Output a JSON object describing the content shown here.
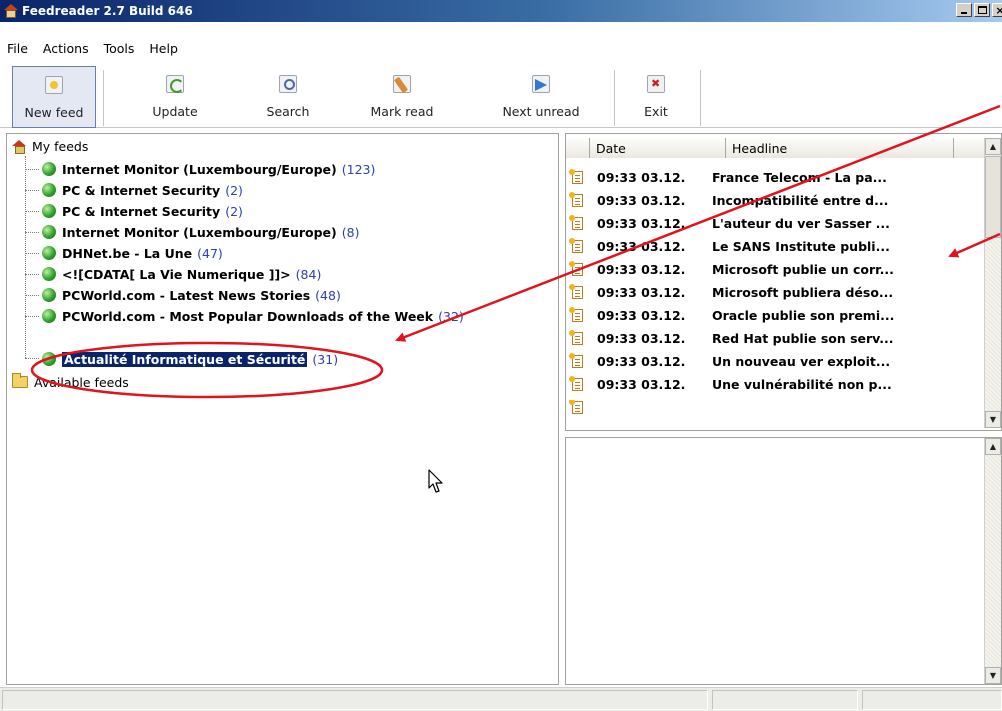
{
  "window": {
    "title": "Feedreader 2.7 Build 646",
    "controls": {
      "minimize": "_",
      "maximize": "□",
      "close": "×"
    }
  },
  "menu": [
    "File",
    "Actions",
    "Tools",
    "Help"
  ],
  "toolbar": {
    "buttons": [
      {
        "label": "New feed",
        "icon": "new-feed-icon",
        "pressed": true
      },
      {
        "label": "Update",
        "icon": "update-icon"
      },
      {
        "label": "Search",
        "icon": "search-icon"
      },
      {
        "label": "Mark read",
        "icon": "mark-read-icon"
      },
      {
        "label": "Next unread",
        "icon": "next-unread-icon"
      },
      {
        "label": "Exit",
        "icon": "exit-icon"
      }
    ]
  },
  "tree": {
    "root_label": "My feeds",
    "feeds": [
      {
        "title": "Internet Monitor (Luxembourg/Europe)",
        "count": "(123)"
      },
      {
        "title": "PC & Internet Security",
        "count": "(2)"
      },
      {
        "title": "PC & Internet Security",
        "count": "(2)"
      },
      {
        "title": "Internet Monitor (Luxembourg/Europe)",
        "count": "(8)"
      },
      {
        "title": "DHNet.be - La Une",
        "count": "(47)"
      },
      {
        "title": "<![CDATA[ La Vie Numerique ]]>",
        "count": "(84)"
      },
      {
        "title": "PCWorld.com - Latest News Stories",
        "count": "(48)"
      },
      {
        "title": "PCWorld.com - Most Popular Downloads of the Week",
        "count": "(32)"
      },
      {
        "title": "Actualité Informatique et Sécurité",
        "count": "(31)",
        "selected": true
      }
    ],
    "available_label": "Available feeds"
  },
  "article_list": {
    "columns": [
      "Date",
      "Headline"
    ],
    "rows": [
      {
        "date": "09:33 03.12.",
        "headline": "France Telecom - La pa..."
      },
      {
        "date": "09:33 03.12.",
        "headline": "Incompatibilité entre d..."
      },
      {
        "date": "09:33 03.12.",
        "headline": "L'auteur du ver Sasser ..."
      },
      {
        "date": "09:33 03.12.",
        "headline": "Le SANS Institute publi..."
      },
      {
        "date": "09:33 03.12.",
        "headline": "Microsoft publie un corr..."
      },
      {
        "date": "09:33 03.12.",
        "headline": "Microsoft publiera déso..."
      },
      {
        "date": "09:33 03.12.",
        "headline": "Oracle publie son premi..."
      },
      {
        "date": "09:33 03.12.",
        "headline": "Red Hat publie son serv..."
      },
      {
        "date": "09:33 03.12.",
        "headline": "Un nouveau ver exploit..."
      },
      {
        "date": "09:33 03.12.",
        "headline": "Une vulnérabilité non p..."
      }
    ]
  },
  "colors": {
    "title_bar_start": "#0a246a",
    "title_bar_end": "#a6caf0",
    "selection": "#0a246a",
    "unread_count": "#2a3fb5",
    "annotation": "#e0141e"
  }
}
